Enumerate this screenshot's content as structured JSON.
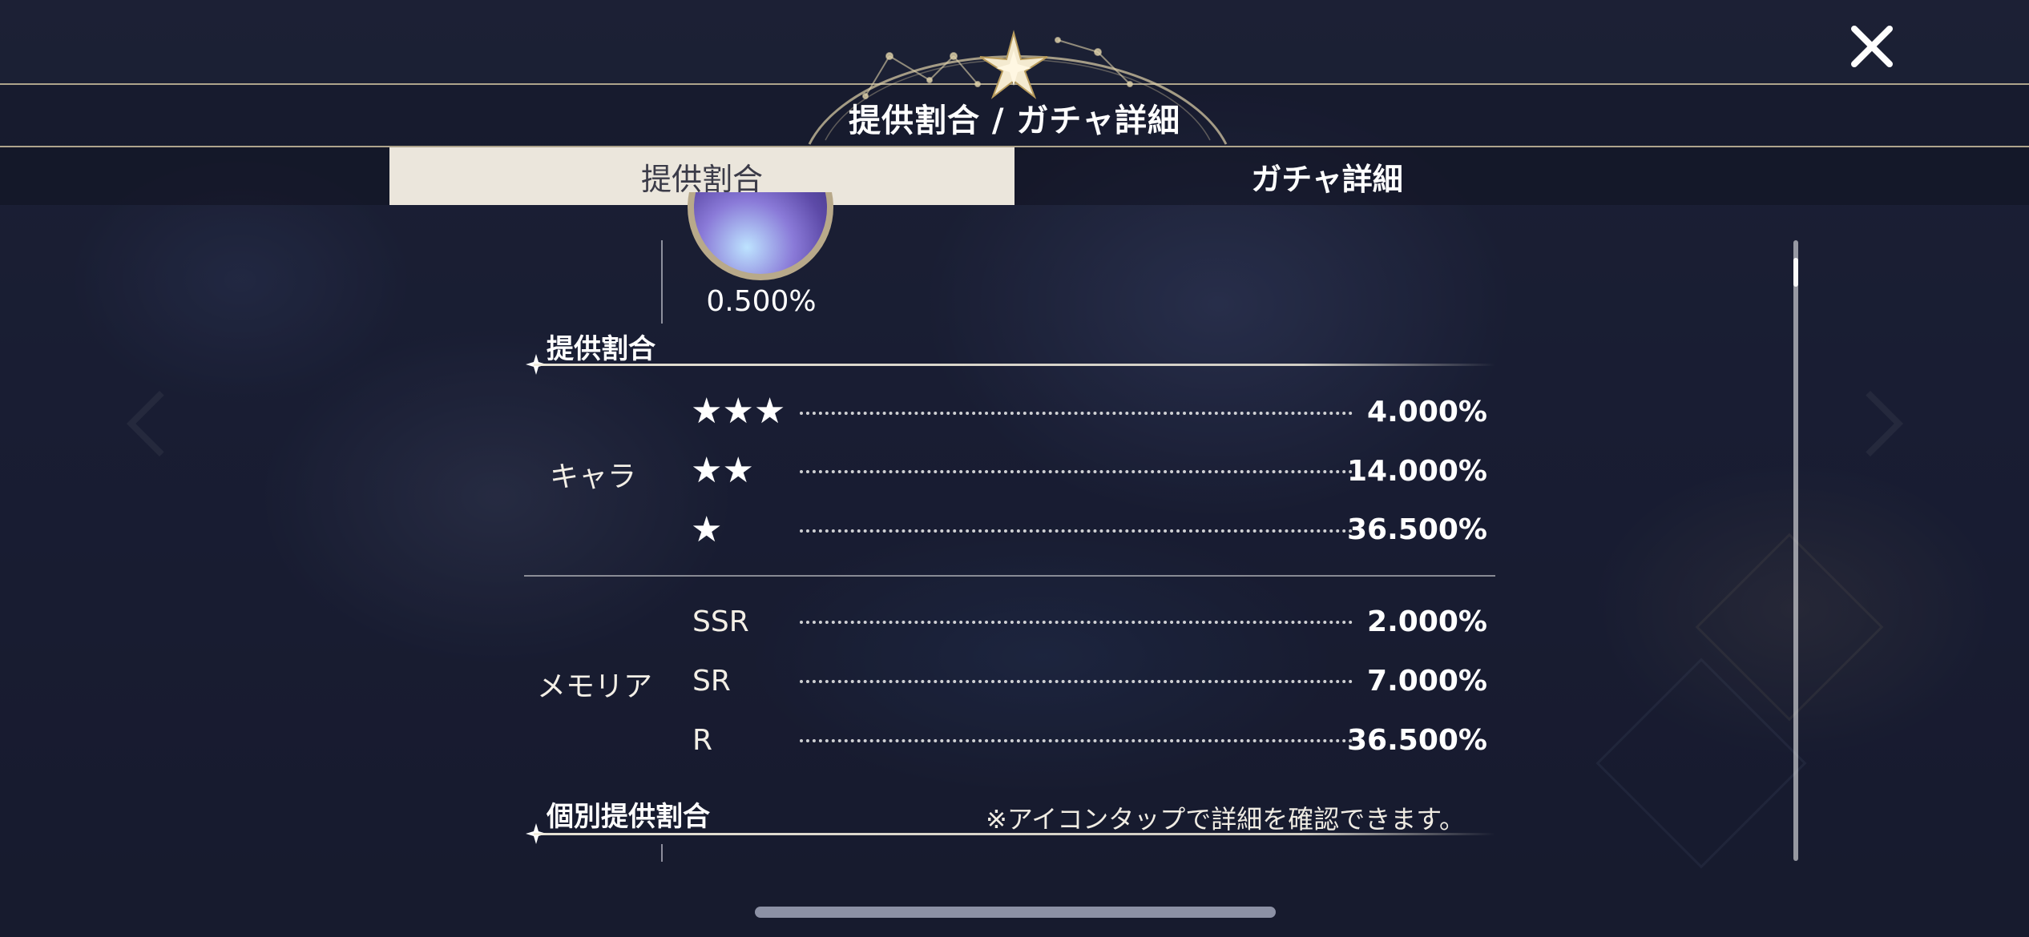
{
  "header": {
    "title": "提供割合 / ガチャ詳細",
    "close_icon": "close-icon"
  },
  "tabs": [
    {
      "label": "提供割合",
      "active": true
    },
    {
      "label": "ガチャ詳細",
      "active": false
    }
  ],
  "top_item": {
    "percent": "0.500%"
  },
  "rates_section": {
    "title": "提供割合",
    "groups": [
      {
        "label": "キャラ",
        "rows": [
          {
            "rarity": "★★★",
            "percent": "4.000%"
          },
          {
            "rarity": "★★",
            "percent": "14.000%"
          },
          {
            "rarity": "★",
            "percent": "36.500%"
          }
        ]
      },
      {
        "label": "メモリア",
        "rows": [
          {
            "rarity": "SSR",
            "percent": "2.000%"
          },
          {
            "rarity": "SR",
            "percent": "7.000%"
          },
          {
            "rarity": "R",
            "percent": "36.500%"
          }
        ]
      }
    ]
  },
  "individual_section": {
    "title": "個別提供割合",
    "note": "※アイコンタップで詳細を確認できます。"
  },
  "colors": {
    "tab_active_bg": "#ebe6dc",
    "accent_gold": "#e0d2aa"
  }
}
